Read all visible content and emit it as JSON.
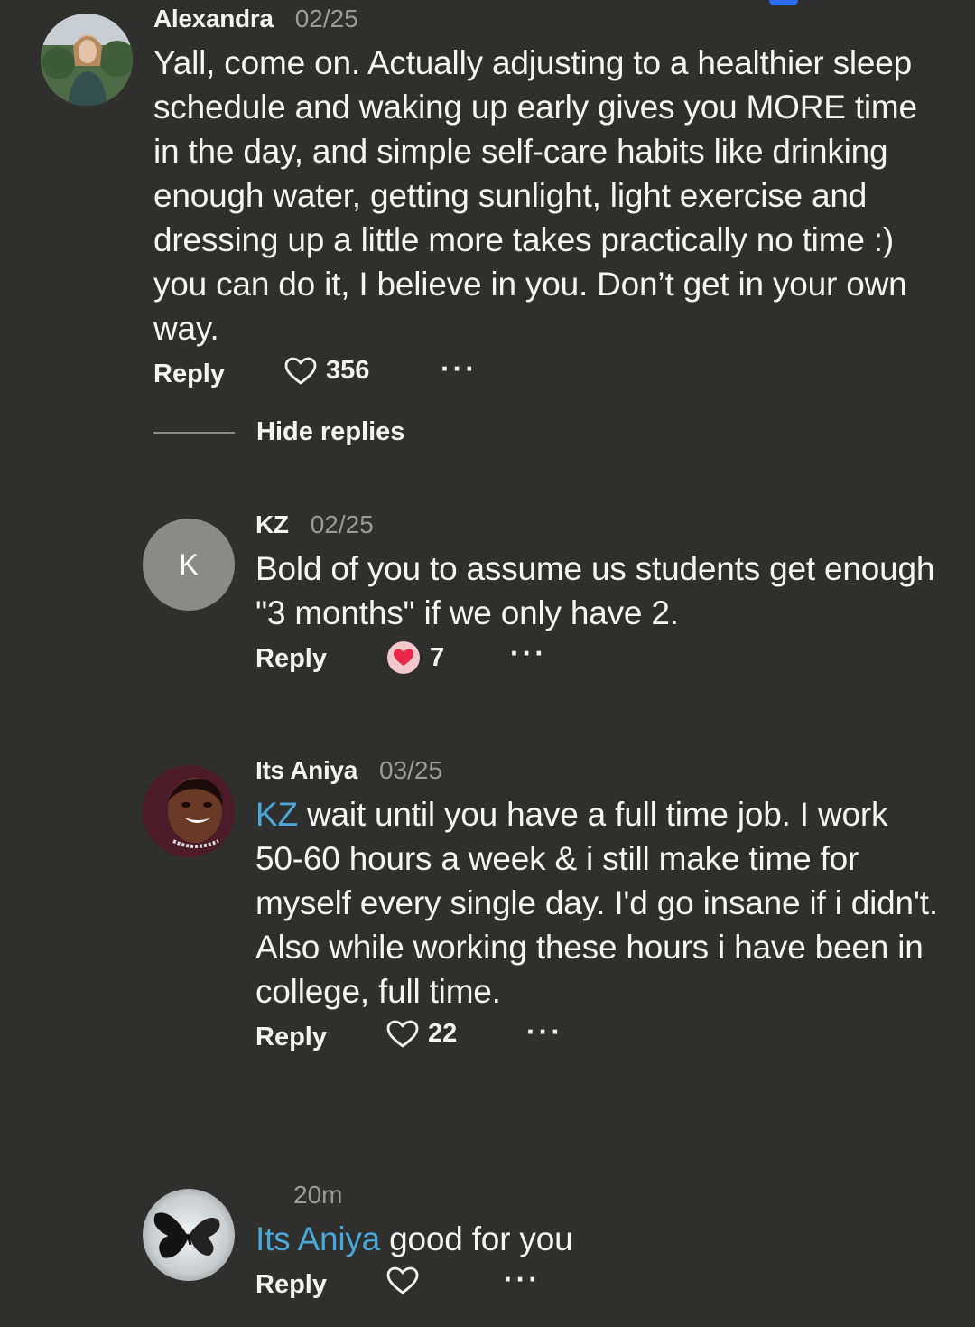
{
  "colors": {
    "background": "#2f2f2d",
    "text": "#f5f5f3",
    "muted": "#9a9a97",
    "mention": "#4aa7d8",
    "liked_heart": "#e8294a"
  },
  "comments": [
    {
      "user": "Alexandra",
      "date": "02/25",
      "text": "Yall, come on. Actually adjusting to a healthier sleep schedule and waking up early gives you MORE time in the day, and simple self-care habits like drinking enough water, getting sunlight, light exercise and dressing up a little more takes practically no time :) you can do it, I believe in you. Don’t get in your own way.",
      "reply_label": "Reply",
      "likes": "356",
      "more_label": "···"
    },
    {
      "user": "KZ",
      "date": "02/25",
      "avatar_letter": "K",
      "text": "Bold of you to assume us students get enough \"3 months\" if we only have 2.",
      "reply_label": "Reply",
      "likes": "7",
      "liked": true,
      "more_label": "···"
    },
    {
      "user": "Its Aniya",
      "date": "03/25",
      "mention": "KZ",
      "text": " wait until you have a full time job. I work 50-60 hours a week & i still make time for myself every single day. I'd go insane if i didn't. Also while working these hours i have been in college, full time.",
      "reply_label": "Reply",
      "likes": "22",
      "more_label": "···"
    },
    {
      "user": "",
      "date": "20m",
      "mention": "Its Aniya",
      "text": " good for you",
      "reply_label": "Reply",
      "likes": "",
      "more_label": "···"
    }
  ],
  "hide_replies_label": "Hide replies"
}
